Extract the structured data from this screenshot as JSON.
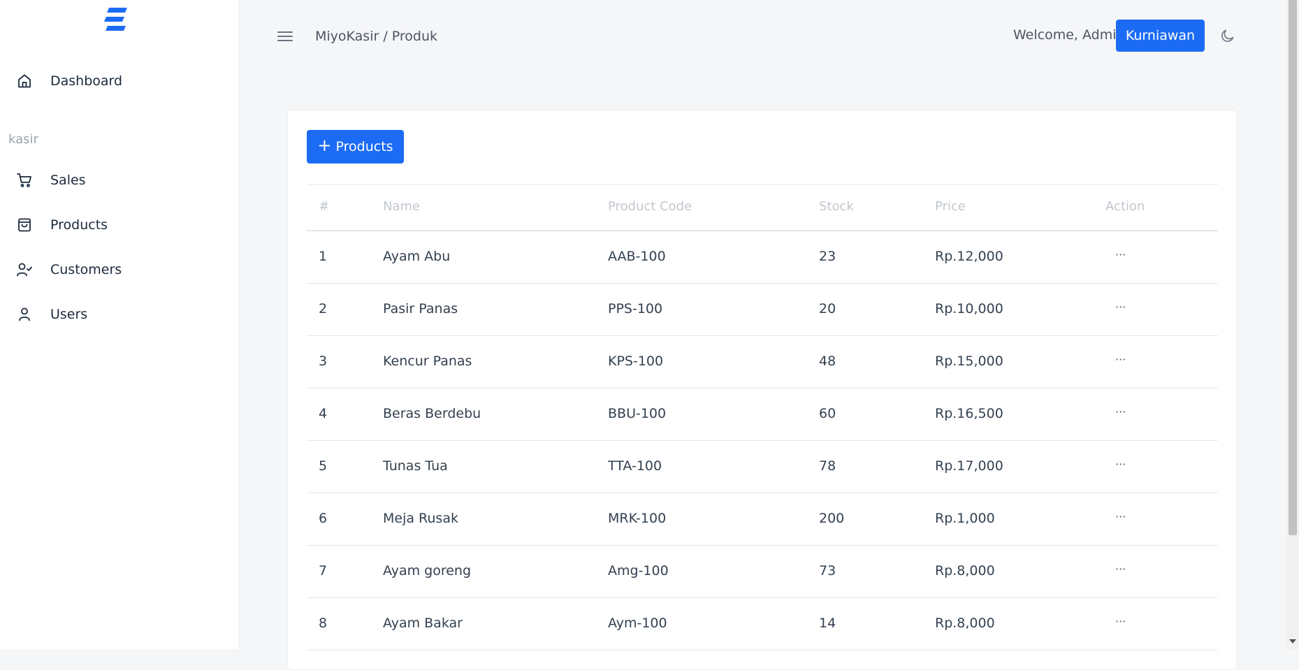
{
  "sidebar": {
    "section_label": "kasir",
    "items": [
      {
        "label": "Dashboard",
        "icon": "home-icon"
      },
      {
        "label": "Sales",
        "icon": "cart-icon"
      },
      {
        "label": "Products",
        "icon": "bag-icon"
      },
      {
        "label": "Customers",
        "icon": "user-check-icon"
      },
      {
        "label": "Users",
        "icon": "user-icon"
      }
    ]
  },
  "header": {
    "breadcrumb": "MiyoKasir / Produk",
    "welcome": "Welcome, Admin",
    "user_name": "Kurniawan"
  },
  "toolbar": {
    "add_label": "Products"
  },
  "table": {
    "columns": [
      "#",
      "Name",
      "Product Code",
      "Stock",
      "Price",
      "Action"
    ],
    "rows": [
      {
        "num": "1",
        "name": "Ayam Abu",
        "code": "AAB-100",
        "stock": "23",
        "price": "Rp.12,000",
        "action": "···"
      },
      {
        "num": "2",
        "name": "Pasir Panas",
        "code": "PPS-100",
        "stock": "20",
        "price": "Rp.10,000",
        "action": "···"
      },
      {
        "num": "3",
        "name": "Kencur Panas",
        "code": "KPS-100",
        "stock": "48",
        "price": "Rp.15,000",
        "action": "···"
      },
      {
        "num": "4",
        "name": "Beras Berdebu",
        "code": "BBU-100",
        "stock": "60",
        "price": "Rp.16,500",
        "action": "···"
      },
      {
        "num": "5",
        "name": "Tunas Tua",
        "code": "TTA-100",
        "stock": "78",
        "price": "Rp.17,000",
        "action": "···"
      },
      {
        "num": "6",
        "name": "Meja Rusak",
        "code": "MRK-100",
        "stock": "200",
        "price": "Rp.1,000",
        "action": "···"
      },
      {
        "num": "7",
        "name": "Ayam goreng",
        "code": "Amg-100",
        "stock": "73",
        "price": "Rp.8,000",
        "action": "···"
      },
      {
        "num": "8",
        "name": "Ayam Bakar",
        "code": "Aym-100",
        "stock": "14",
        "price": "Rp.8,000",
        "action": "···"
      }
    ]
  },
  "colors": {
    "primary": "#1c6bf5",
    "background": "#f5f6f8",
    "sidebar": "#ffffff"
  }
}
